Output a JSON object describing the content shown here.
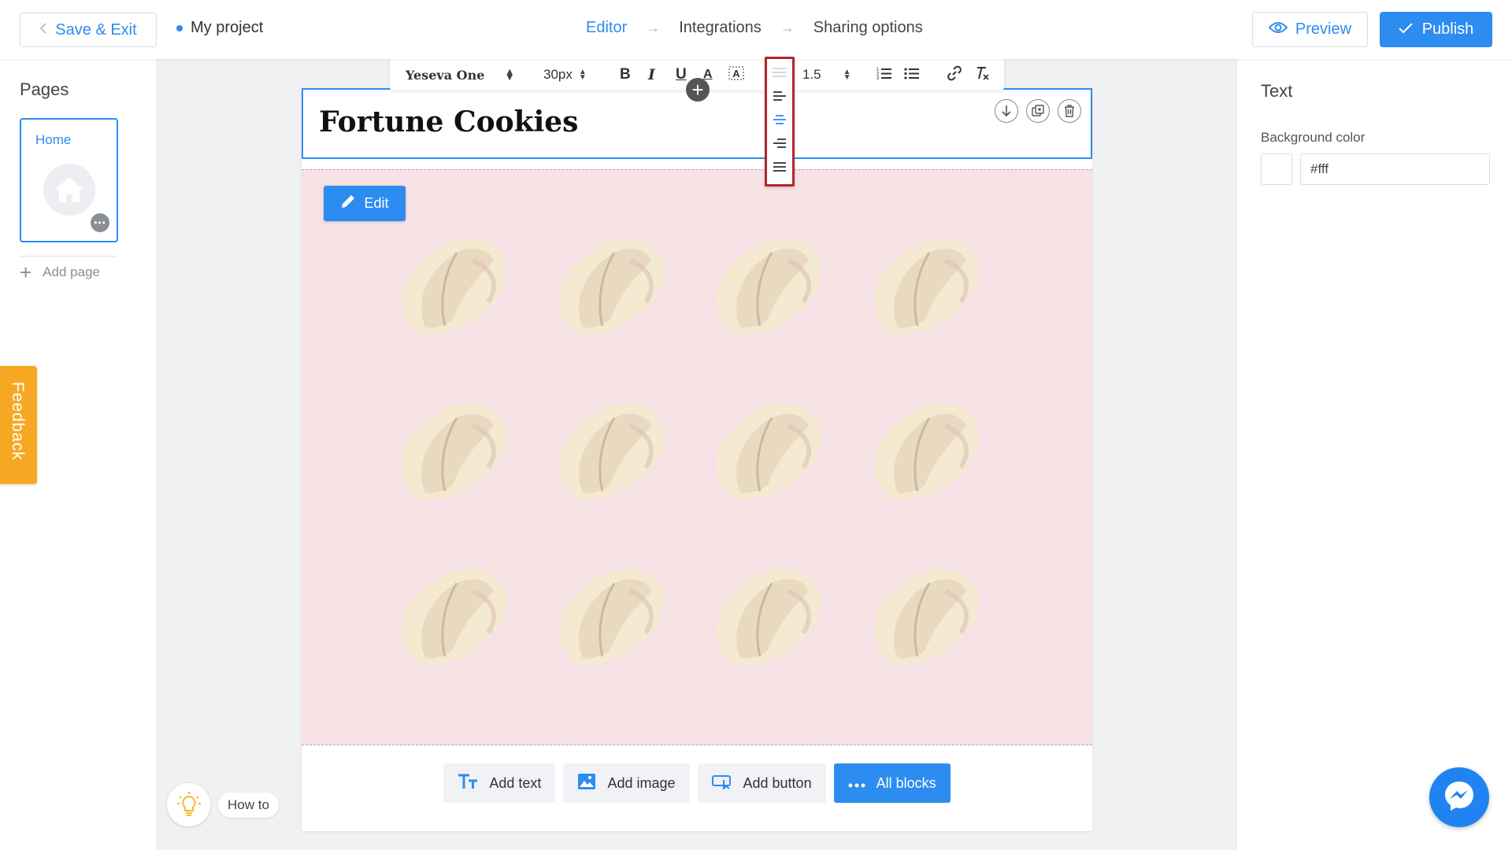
{
  "topbar": {
    "save_exit_label": "Save & Exit",
    "project_name": "My project",
    "steps": [
      "Editor",
      "Integrations",
      "Sharing options"
    ],
    "preview_label": "Preview",
    "publish_label": "Publish"
  },
  "left_panel": {
    "title": "Pages",
    "pages": [
      {
        "label": "Home"
      }
    ],
    "add_page_label": "Add page"
  },
  "feedback_label": "Feedback",
  "toolbar": {
    "font": "Yeseva One",
    "font_size": "30px",
    "line_height": "1.5",
    "bold": "B",
    "italic": "I",
    "underline": "U",
    "color": "A"
  },
  "align_options": [
    "align-none",
    "align-left",
    "align-center",
    "align-right",
    "align-justify"
  ],
  "canvas": {
    "heading": "Fortune Cookies",
    "edit_label": "Edit",
    "add_buttons": [
      {
        "label": "Add text",
        "icon": "text-icon"
      },
      {
        "label": "Add image",
        "icon": "image-icon"
      },
      {
        "label": "Add button",
        "icon": "button-icon"
      },
      {
        "label": "All blocks",
        "icon": "more-icon"
      }
    ]
  },
  "right_panel": {
    "title": "Text",
    "bg_label": "Background color",
    "bg_value": "#fff"
  },
  "how_to_label": "How to",
  "colors": {
    "accent": "#2d8cf0",
    "feedback": "#f7a823",
    "image_bg": "#f6e2e5",
    "highlight": "#b3262a"
  }
}
